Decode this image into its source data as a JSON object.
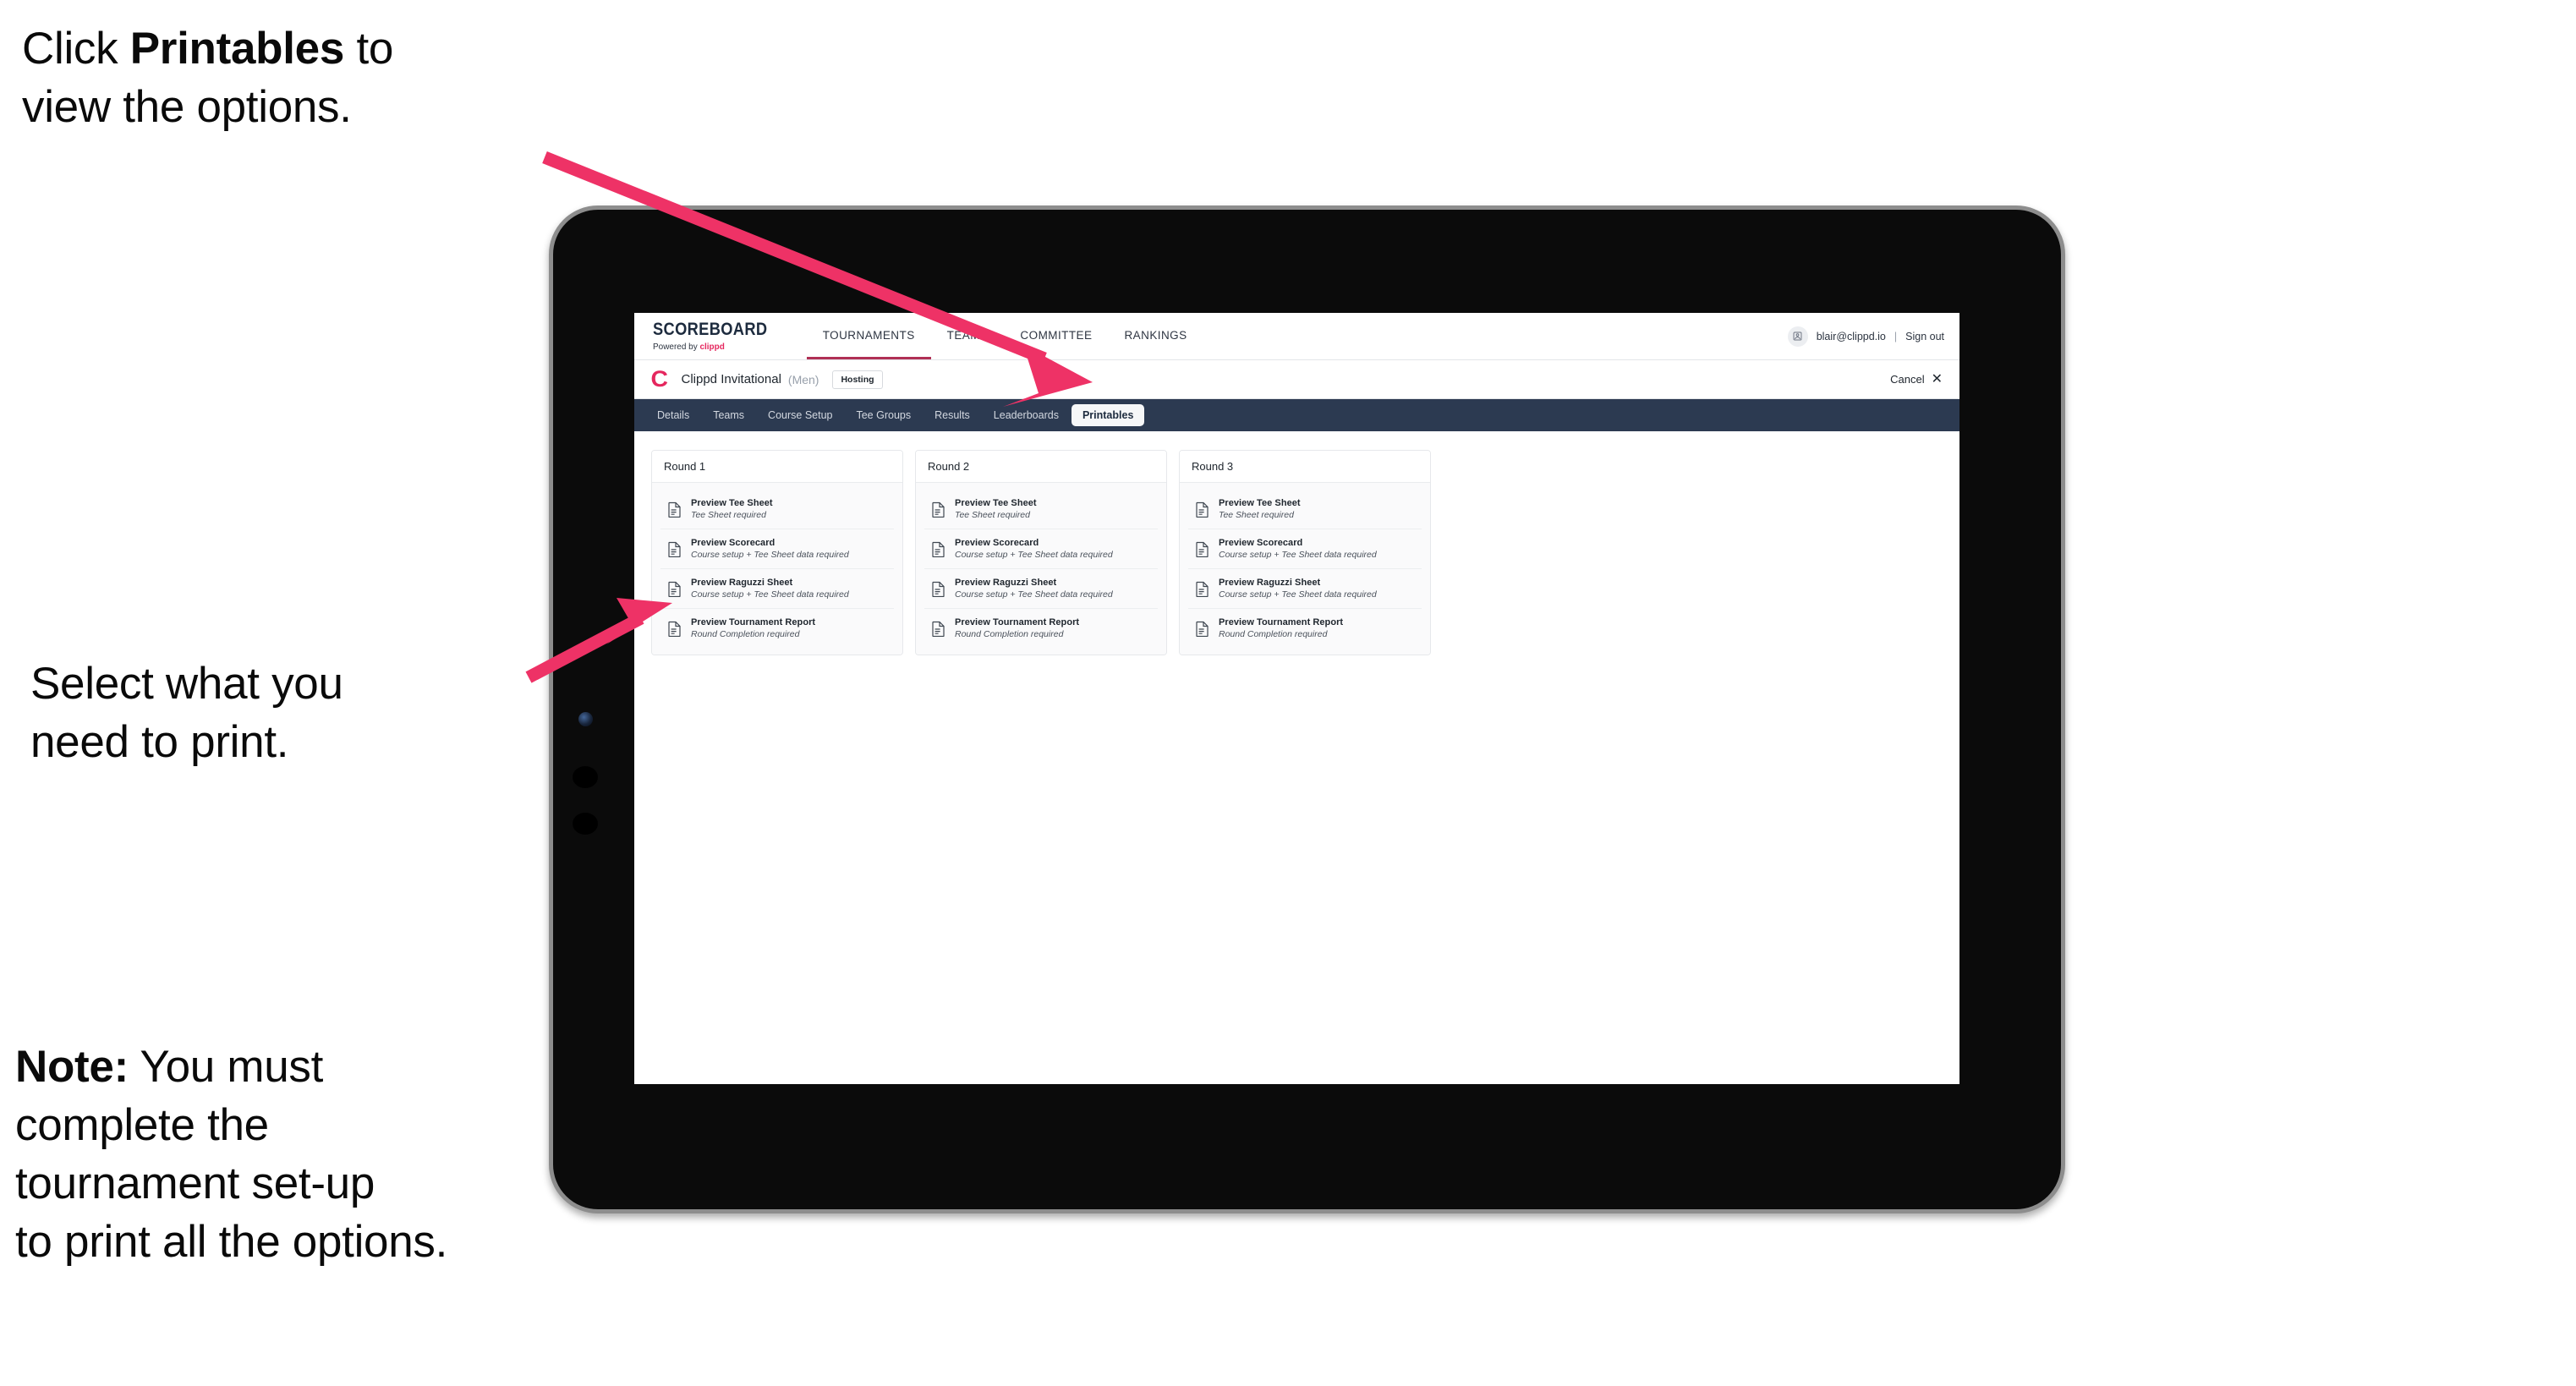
{
  "annotations": {
    "click_printables": {
      "prefix": "Click ",
      "bold": "Printables",
      "suffix": " to\nview the options."
    },
    "select_print": "Select what you\n need to print.",
    "note": {
      "bold": "Note:",
      "rest": " You must\ncomplete the\ntournament set-up\nto print all the options."
    }
  },
  "app": {
    "brand": {
      "title": "SCOREBOARD",
      "powered_prefix": "Powered by ",
      "powered_brand": "clippd"
    },
    "main_nav": [
      {
        "label": "TOURNAMENTS",
        "active": true
      },
      {
        "label": "TEAMS",
        "active": false
      },
      {
        "label": "COMMITTEE",
        "active": false
      },
      {
        "label": "RANKINGS",
        "active": false
      }
    ],
    "account": {
      "avatar_icon": "user-avatar-icon",
      "email": "blair@clippd.io",
      "separator": "|",
      "sign_out": "Sign out"
    },
    "tournament_bar": {
      "logo_letter": "C",
      "name": "Clippd Invitational",
      "gender": "(Men)",
      "status_badge": "Hosting",
      "cancel_label": "Cancel",
      "cancel_icon": "close-icon"
    },
    "tabs": [
      {
        "label": "Details",
        "active": false
      },
      {
        "label": "Teams",
        "active": false
      },
      {
        "label": "Course Setup",
        "active": false
      },
      {
        "label": "Tee Groups",
        "active": false
      },
      {
        "label": "Results",
        "active": false
      },
      {
        "label": "Leaderboards",
        "active": false
      },
      {
        "label": "Printables",
        "active": true
      }
    ],
    "rounds": [
      {
        "title": "Round 1",
        "items": [
          {
            "title": "Preview Tee Sheet",
            "sub": "Tee Sheet required",
            "icon": "document-icon"
          },
          {
            "title": "Preview Scorecard",
            "sub": "Course setup + Tee Sheet data required",
            "icon": "document-icon"
          },
          {
            "title": "Preview Raguzzi Sheet",
            "sub": "Course setup + Tee Sheet data required",
            "icon": "document-icon"
          },
          {
            "title": "Preview Tournament Report",
            "sub": "Round Completion required",
            "icon": "document-icon"
          }
        ]
      },
      {
        "title": "Round 2",
        "items": [
          {
            "title": "Preview Tee Sheet",
            "sub": "Tee Sheet required",
            "icon": "document-icon"
          },
          {
            "title": "Preview Scorecard",
            "sub": "Course setup + Tee Sheet data required",
            "icon": "document-icon"
          },
          {
            "title": "Preview Raguzzi Sheet",
            "sub": "Course setup + Tee Sheet data required",
            "icon": "document-icon"
          },
          {
            "title": "Preview Tournament Report",
            "sub": "Round Completion required",
            "icon": "document-icon"
          }
        ]
      },
      {
        "title": "Round 3",
        "items": [
          {
            "title": "Preview Tee Sheet",
            "sub": "Tee Sheet required",
            "icon": "document-icon"
          },
          {
            "title": "Preview Scorecard",
            "sub": "Course setup + Tee Sheet data required",
            "icon": "document-icon"
          },
          {
            "title": "Preview Raguzzi Sheet",
            "sub": "Course setup + Tee Sheet data required",
            "icon": "document-icon"
          },
          {
            "title": "Preview Tournament Report",
            "sub": "Round Completion required",
            "icon": "document-icon"
          }
        ]
      }
    ]
  },
  "colors": {
    "accent_pink": "#ec2a60",
    "tabbar_dark": "#2c3a51",
    "brand_navy": "#1d2b3e",
    "arrow_pink": "#ee3266"
  }
}
